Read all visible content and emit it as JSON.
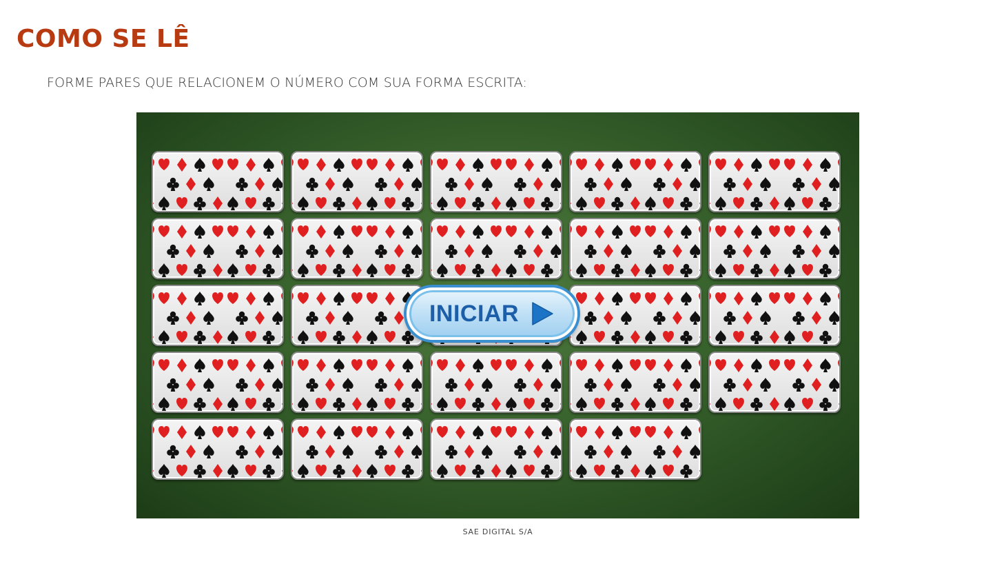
{
  "header": {
    "title": "COMO SE LÊ",
    "instruction": "FORME PARES QUE RELACIONEM O NÚMERO COM SUA FORMA ESCRITA:"
  },
  "game": {
    "card_rows": [
      5,
      5,
      5,
      5,
      4
    ],
    "card_back_icon": "playing-card-suits-pattern",
    "start_button_label": "INICIAR",
    "start_button_icon": "play-arrow-icon",
    "colors": {
      "table_felt": "#3d6830",
      "suit_red": "#e02020",
      "suit_black": "#111111",
      "button_text": "#1c5fa8",
      "title": "#b83a10"
    }
  },
  "footer": {
    "caption": "SAE DIGITAL S/A"
  }
}
